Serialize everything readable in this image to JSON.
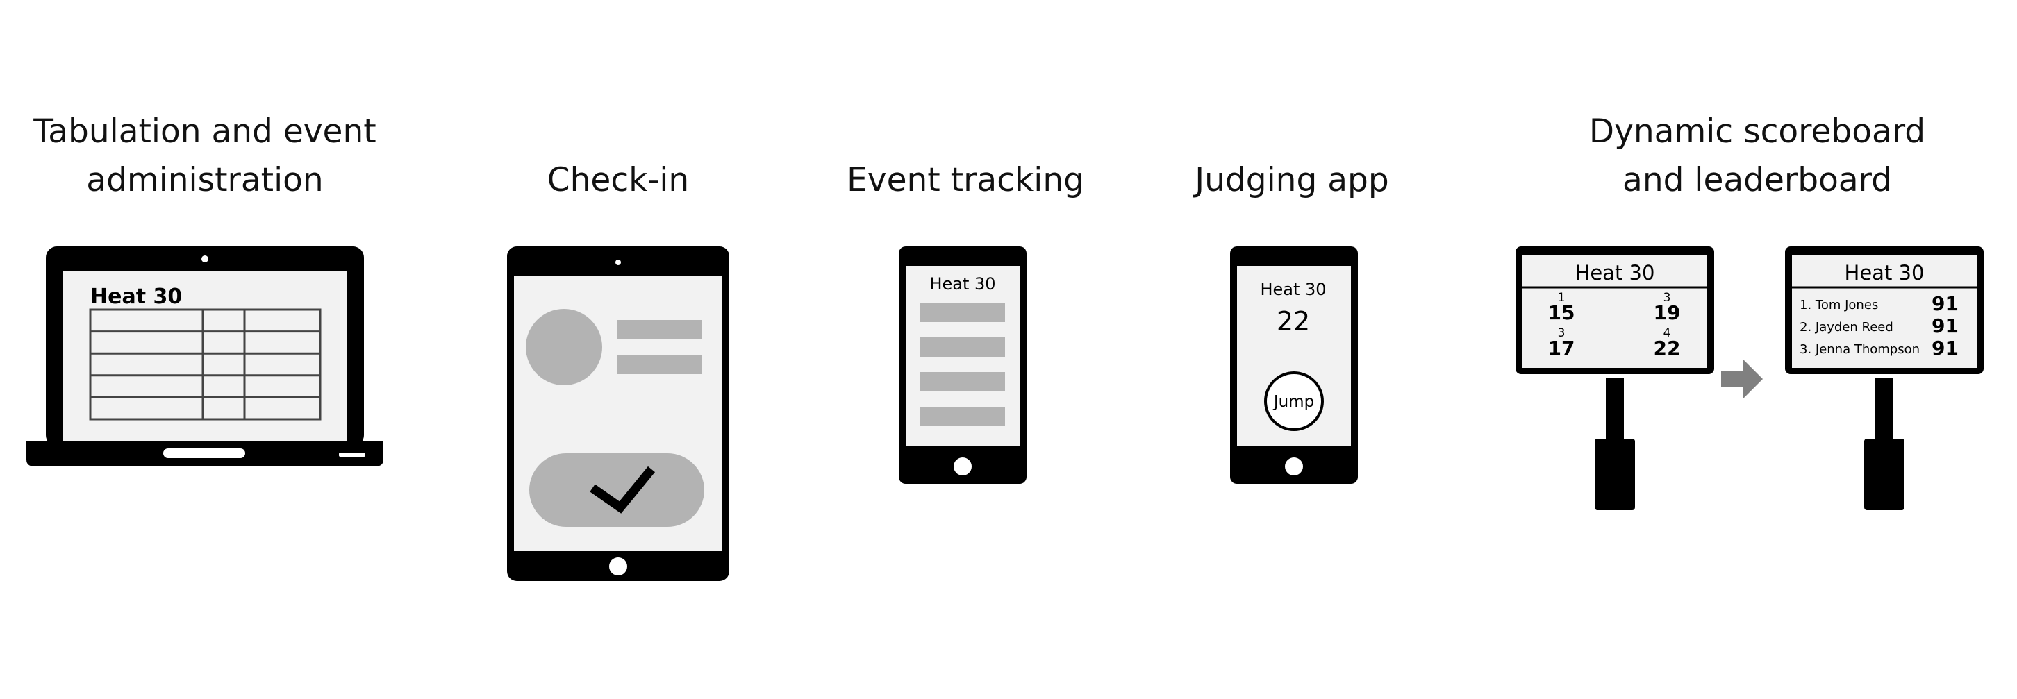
{
  "captions": {
    "admin": [
      "Tabulation and event",
      "administration"
    ],
    "checkin": "Check-in",
    "tracking": "Event tracking",
    "judging": "Judging app",
    "scoreboard": [
      "Dynamic scoreboard",
      "and leaderboard"
    ]
  },
  "laptop": {
    "heading": "Heat 30",
    "table": {
      "rows": 5,
      "cols": 3
    }
  },
  "tablet": {
    "icons": [
      "avatar-icon",
      "checkmark-icon"
    ]
  },
  "tracking_phone": {
    "heading": "Heat 30",
    "rows": 4
  },
  "judging_phone": {
    "heading": "Heat 30",
    "score": "22",
    "button": "Jump"
  },
  "scoreboard": {
    "heading": "Heat 30",
    "entries": [
      {
        "rank": "1",
        "score": "15"
      },
      {
        "rank": "3",
        "score": "19"
      },
      {
        "rank": "3",
        "score": "17"
      },
      {
        "rank": "4",
        "score": "22"
      }
    ]
  },
  "leaderboard": {
    "heading": "Heat 30",
    "entries": [
      {
        "name": "1. Tom Jones",
        "score": "91"
      },
      {
        "name": "2. Jayden Reed",
        "score": "91"
      },
      {
        "name": "3. Jenna Thompson",
        "score": "91"
      }
    ]
  },
  "colors": {
    "device": "#000000",
    "screen": "#f2f2f2",
    "placeholder": "#b3b3b3",
    "arrow": "#808080"
  }
}
